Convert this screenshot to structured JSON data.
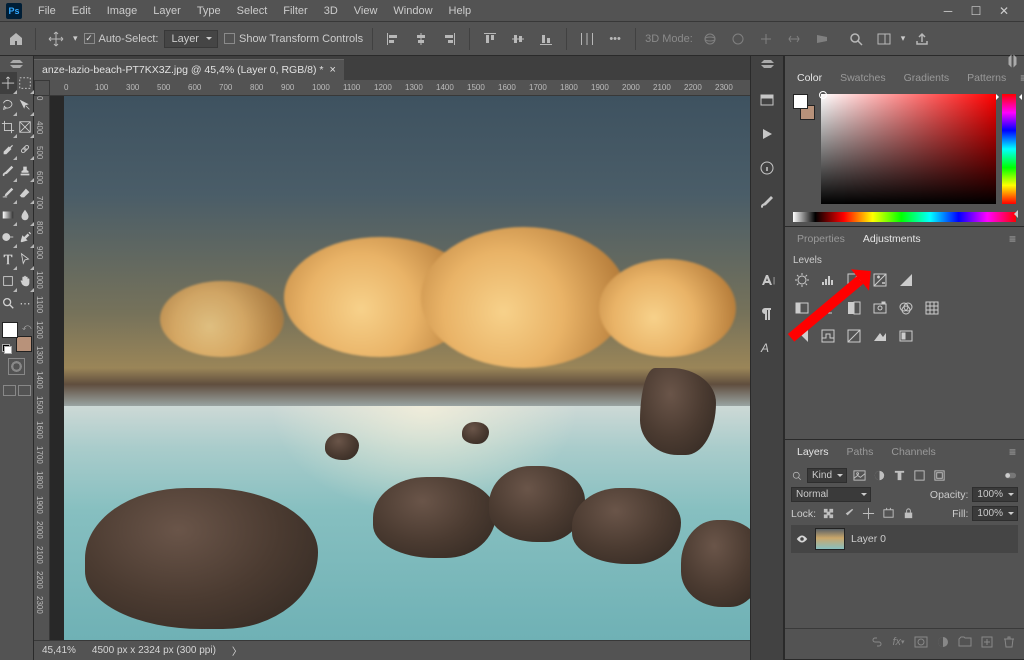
{
  "app": {
    "name": "Ps"
  },
  "menu": [
    "File",
    "Edit",
    "Image",
    "Layer",
    "Type",
    "Select",
    "Filter",
    "3D",
    "View",
    "Window",
    "Help"
  ],
  "options": {
    "autoSelect": {
      "checked": true,
      "label": "Auto-Select:"
    },
    "layerDD": "Layer",
    "transform": {
      "checked": false,
      "label": "Show Transform Controls"
    },
    "mode3d": "3D Mode:"
  },
  "document": {
    "tab": "anze-lazio-beach-PT7KX3Z.jpg @ 45,4% (Layer 0, RGB/8) *",
    "zoom": "45,41%",
    "dims": "4500 px x 2324 px (300 ppi)"
  },
  "ruler": {
    "h": [
      "0",
      "100",
      "300",
      "500",
      "600",
      "700",
      "800",
      "900",
      "1000",
      "1100",
      "1200",
      "1300",
      "1400",
      "1500",
      "1600",
      "1700",
      "1800",
      "1900",
      "2000",
      "2100",
      "2200",
      "2300"
    ],
    "v": [
      "0",
      "400",
      "500",
      "600",
      "700",
      "800",
      "900",
      "1000",
      "1100",
      "1200",
      "1300",
      "1400",
      "1500",
      "1600",
      "1700",
      "1800",
      "1900",
      "2000",
      "2100",
      "2200",
      "2300"
    ]
  },
  "panels": {
    "color": {
      "tabs": [
        "Color",
        "Swatches",
        "Gradients",
        "Patterns"
      ],
      "active": 0
    },
    "adjust": {
      "tabs": [
        "Properties",
        "Adjustments"
      ],
      "active": 1,
      "tooltip": "Levels"
    },
    "layers": {
      "tabs": [
        "Layers",
        "Paths",
        "Channels"
      ],
      "active": 0,
      "filter": "Kind",
      "blend": "Normal",
      "opacityLabel": "Opacity:",
      "opacity": "100%",
      "lockLabel": "Lock:",
      "fillLabel": "Fill:",
      "fill": "100%",
      "items": [
        {
          "name": "Layer 0"
        }
      ]
    }
  }
}
